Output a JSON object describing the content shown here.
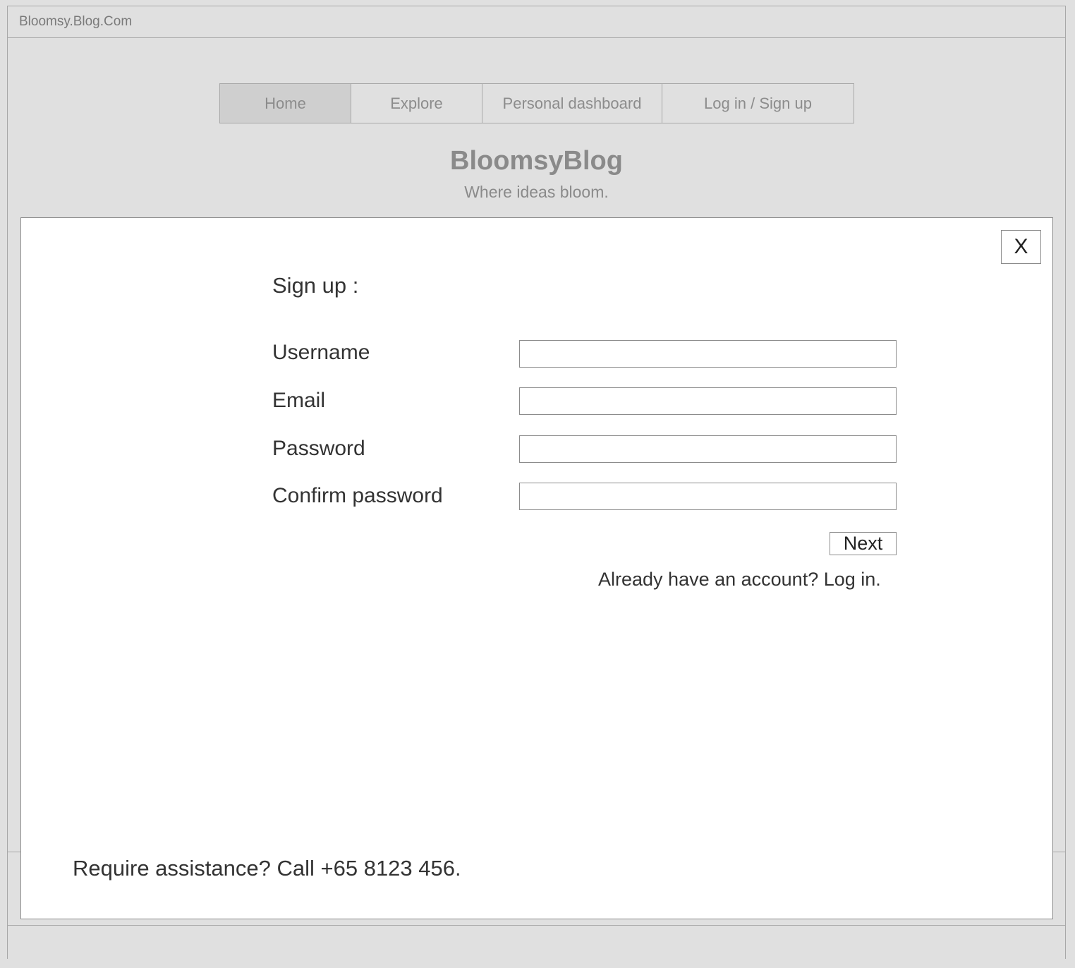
{
  "browser": {
    "url": "Bloomsy.Blog.Com"
  },
  "nav": {
    "tabs": [
      {
        "label": "Home"
      },
      {
        "label": "Explore"
      },
      {
        "label": "Personal dashboard"
      },
      {
        "label": "Log in / Sign up"
      }
    ]
  },
  "brand": {
    "title": "BloomsyBlog",
    "tagline": "Where ideas bloom."
  },
  "modal": {
    "close_label": "X",
    "title": "Sign up :",
    "fields": {
      "username_label": "Username",
      "email_label": "Email",
      "password_label": "Password",
      "confirm_label": "Confirm password"
    },
    "next_label": "Next",
    "login_link": "Already have an account? Log in.",
    "assistance": "Require assistance? Call +65 8123 456."
  }
}
